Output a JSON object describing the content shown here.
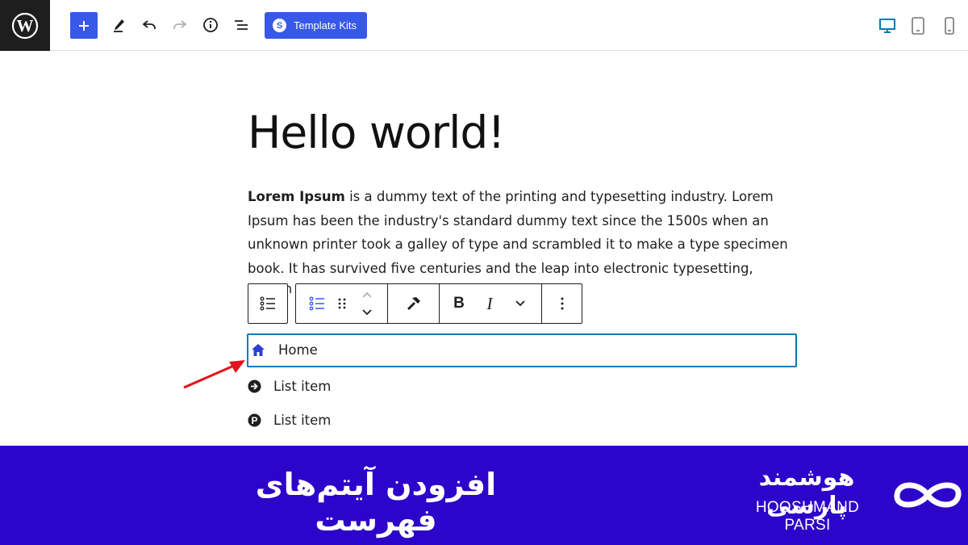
{
  "toolbar": {
    "template_kits_label": "Template Kits",
    "template_kits_icon": "S",
    "accent_color": "#3858e9"
  },
  "post": {
    "title": "Hello world!",
    "paragraph_bold": "Lorem Ipsum",
    "paragraph_lines": [
      " is a dummy text of the printing and typesetting industry. Lorem",
      "Ipsum has been the industry's standard dummy text since the 1500s when an",
      "unknown printer took a galley of type and scrambled it to make a type specimen",
      "book. It has survived five centuries and the leap into electronic typesetting,"
    ],
    "partial_hidden_text": "h"
  },
  "block_toolbar": {
    "bold_label": "B",
    "italic_label": "I"
  },
  "list": {
    "items": [
      {
        "label": "Home",
        "icon": "home-icon"
      },
      {
        "label": "List item",
        "icon": "arrow-circle-icon"
      },
      {
        "label": "List item",
        "icon": "pinterest-icon"
      }
    ],
    "selected_border_color": "#007cba"
  },
  "banner": {
    "title": "افزودن آیتم‌های فهرست",
    "brand_fa": "هوشمند پارسی",
    "brand_en": "HOOSHMAND PARSI",
    "background_color": "#2d04c9"
  }
}
